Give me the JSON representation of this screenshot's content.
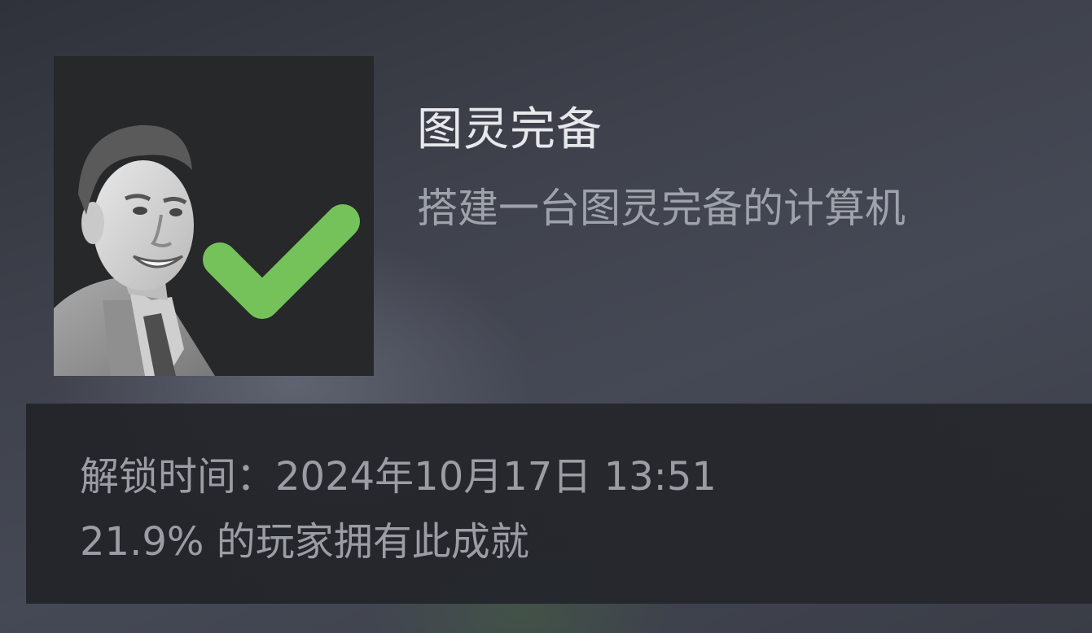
{
  "achievement": {
    "title": "图灵完备",
    "description": "搭建一台图灵完备的计算机",
    "icon": "turing-portrait-checkmark-icon",
    "check_color": "#76c25a"
  },
  "stats": {
    "unlock_label": "解锁时间：",
    "unlock_time": "2024年10月17日 13:51",
    "global_pct": "21.9%",
    "global_pct_text": " 的玩家拥有此成就"
  },
  "colors": {
    "background": "#3d4049",
    "panel": "#232529",
    "title": "#e6e8ec",
    "text_muted": "#9a9da4"
  }
}
